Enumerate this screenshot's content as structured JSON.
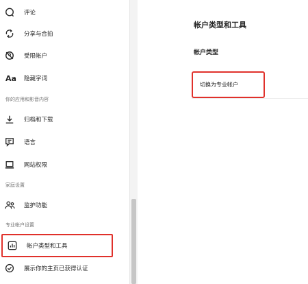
{
  "sidebar": {
    "items": [
      {
        "label": "评论",
        "icon": "comment-icon"
      },
      {
        "label": "分享与合拍",
        "icon": "share-remix-icon"
      },
      {
        "label": "受限帐户",
        "icon": "restricted-icon"
      },
      {
        "label": "隐藏字词",
        "icon": "hidden-words-icon"
      },
      {
        "label": "归档和下载",
        "icon": "download-icon"
      },
      {
        "label": "语言",
        "icon": "language-icon"
      },
      {
        "label": "网站权限",
        "icon": "laptop-icon"
      },
      {
        "label": "监护功能",
        "icon": "supervision-icon"
      },
      {
        "label": "帐户类型和工具",
        "icon": "chart-icon"
      },
      {
        "label": "展示你的主页已获得认证",
        "icon": "verified-icon"
      }
    ],
    "sections": {
      "apps_media": "你的应用和影音内容",
      "family": "家庭设置",
      "professional": "专业帐户设置"
    }
  },
  "main": {
    "title": "帐户类型和工具",
    "subtitle": "帐户类型",
    "switch_label": "切换为专业帐户"
  },
  "colors": {
    "highlight": "#e0312b"
  }
}
